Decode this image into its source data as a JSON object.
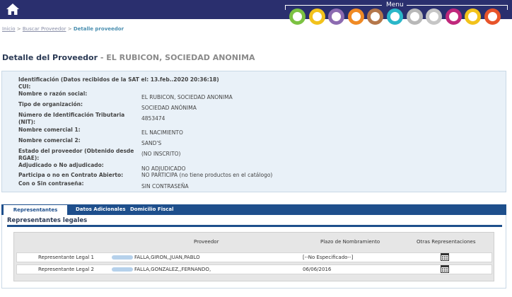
{
  "header": {
    "menu_label": "Menu",
    "menu_colors": [
      "#7cc242",
      "#f2c21b",
      "#8c6bb1",
      "#f08a24",
      "#b5774a",
      "#2ab7c9",
      "#b8b8b8",
      "#c6c6c6",
      "#c0287c",
      "#f2c21b",
      "#e8542a"
    ]
  },
  "breadcrumb": {
    "inicio": "Inicio",
    "sep1": ">",
    "buscar": "Buscar Proveedor",
    "sep2": ">",
    "current": "Detalle proveedor"
  },
  "page": {
    "title": "Detalle del Proveedor",
    "name": "- EL RUBICON, SOCIEDAD ANONIMA"
  },
  "info": {
    "identificacion": "Identificación (Datos recibidos de la SAT el: 13.feb..2020 20:36:18)",
    "cui_label": "CUI:",
    "nombre_label": "Nombre o razón social:",
    "nombre_value": "EL RUBICON, SOCIEDAD ANONIMA",
    "tipo_label": "Tipo de organización:",
    "tipo_value": "SOCIEDAD ANÓNIMA",
    "nit_label_1": "Número de Identificación Tributaria",
    "nit_label_2": "(NIT):",
    "nit_value": "4853474",
    "nc1_label": "Nombre comercial 1:",
    "nc1_value": "EL NACIMIENTO",
    "nc2_label": "Nombre comercial 2:",
    "nc2_value": "SAND'S",
    "estado_label_1": "Estado del proveedor (Obtenido desde",
    "estado_label_2": "RGAE):",
    "estado_value": "(NO INSCRITO)",
    "adjudicado_label": "Adjudicado o No adjudicado:",
    "adjudicado_value": "NO ADJUDICADO",
    "participa_label": "Participa o no en Contrato Abierto:",
    "participa_value": "NO PARTICIPA (no tiene productos en el catálogo)",
    "contrasena_label": "Con o Sin contraseña:",
    "contrasena_value": "SIN CONTRASEÑA"
  },
  "tabs": [
    "Representantes Legales",
    "Datos Adicionales",
    "Domicilio Fiscal"
  ],
  "representantes": {
    "section_title": "Representantes legales",
    "columns": [
      "Proveedor",
      "Plazo de Nombramiento",
      "Otras Representaciones"
    ],
    "rows": [
      {
        "label": "Representante Legal 1",
        "name": "FALLA,GIRON,,JUAN,PABLO",
        "plazo": "[--No Especificado--]",
        "icon": "calendar-icon"
      },
      {
        "label": "Representante Legal 2",
        "name": "FALLA,GONZALEZ,,FERNANDO,",
        "plazo": "06/06/2016",
        "icon": "calendar-icon"
      }
    ]
  }
}
